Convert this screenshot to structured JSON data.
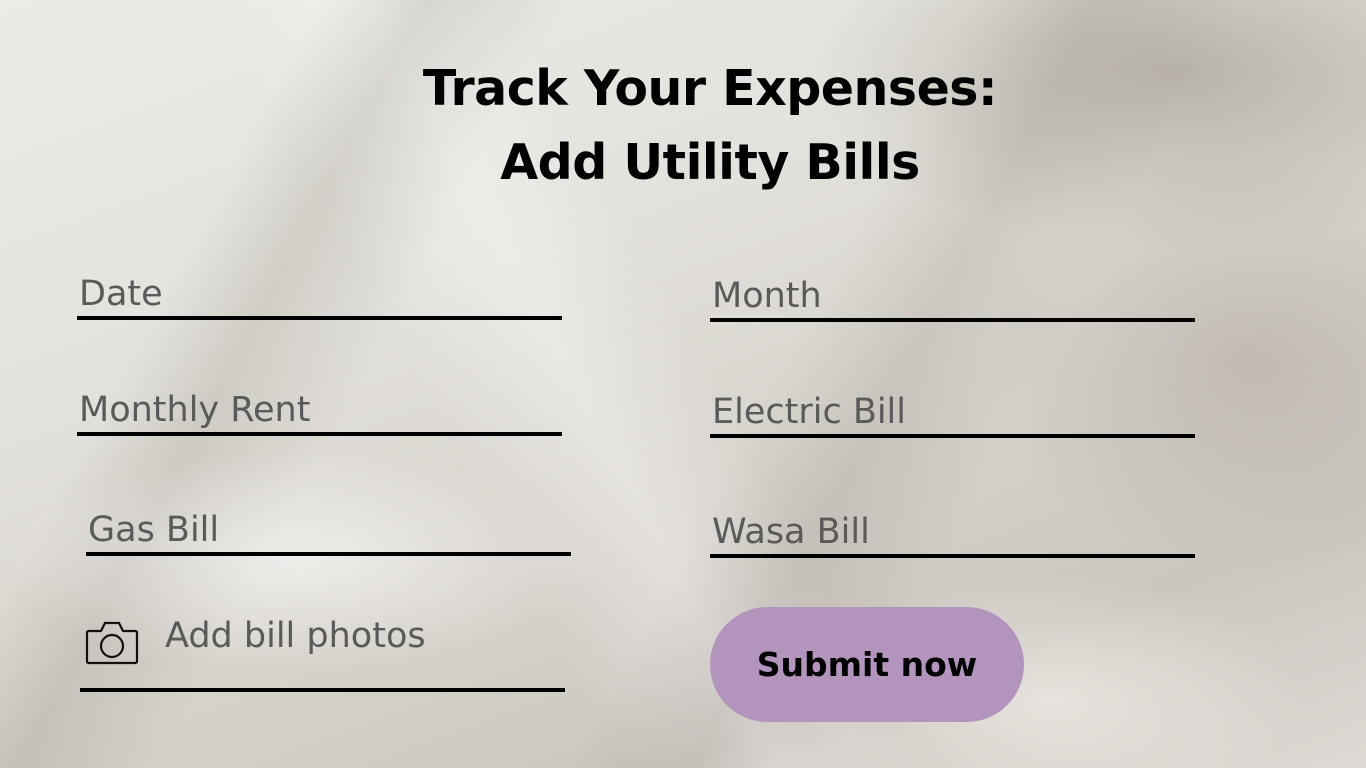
{
  "header": {
    "title_line1": "Track Your Expenses:",
    "title_line2": "Add Utility Bills"
  },
  "form": {
    "date_label": "Date",
    "month_label": "Month",
    "monthly_rent_label": "Monthly Rent",
    "electric_bill_label": "Electric Bill",
    "gas_bill_label": "Gas Bill",
    "wasa_bill_label": "Wasa Bill",
    "add_photos_label": "Add bill photos",
    "submit_label": "Submit now"
  },
  "icons": {
    "camera": "camera-icon"
  },
  "colors": {
    "accent": "#b394bd",
    "label_text": "#5a5a5a",
    "title_text": "#000000"
  }
}
